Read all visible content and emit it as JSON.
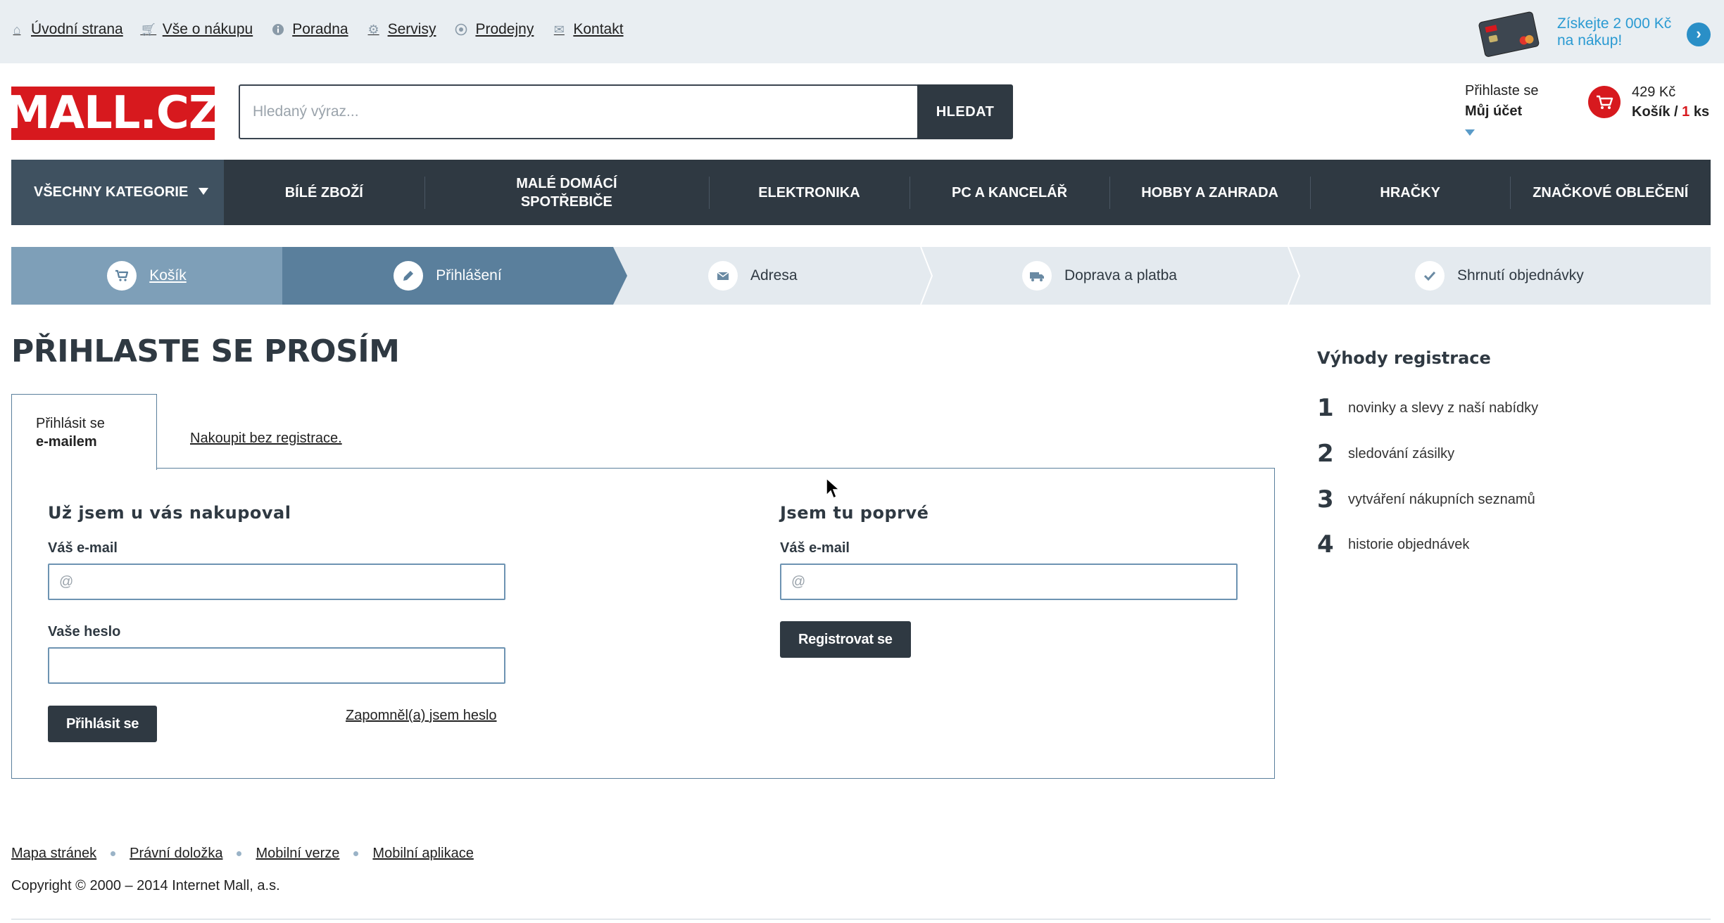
{
  "toplinks": [
    {
      "label": "Úvodní strana",
      "icon": "home-icon"
    },
    {
      "label": "Vše o nákupu",
      "icon": "cart-icon"
    },
    {
      "label": "Poradna",
      "icon": "info-icon"
    },
    {
      "label": "Servisy",
      "icon": "gear-icon"
    },
    {
      "label": "Prodejny",
      "icon": "store-icon"
    },
    {
      "label": "Kontakt",
      "icon": "mail-icon"
    }
  ],
  "promo": {
    "line1": "Získejte 2 000 Kč",
    "line2": "na nákup!"
  },
  "header": {
    "logo": "MALL.CZ",
    "search_placeholder": "Hledaný výraz...",
    "search_button": "HLEDAT",
    "account_line1": "Přihlaste se",
    "account_line2": "Můj účet",
    "cart_price": "429 Kč",
    "cart_label": "Košík / ",
    "cart_qty": "1",
    "cart_unit": " ks"
  },
  "categories": {
    "all": "VŠECHNY KATEGORIE",
    "items": [
      "BÍLÉ ZBOŽÍ",
      "MALÉ DOMÁCÍ SPOTŘEBIČE",
      "ELEKTRONIKA",
      "PC A KANCELÁŘ",
      "HOBBY A ZAHRADA",
      "HRAČKY",
      "ZNAČKOVÉ OBLEČENÍ"
    ]
  },
  "steps": [
    {
      "label": "Košík",
      "icon": "cart-icon",
      "state": "done"
    },
    {
      "label": "Přihlášení",
      "icon": "pencil-icon",
      "state": "active"
    },
    {
      "label": "Adresa",
      "icon": "envelope-icon",
      "state": "pending"
    },
    {
      "label": "Doprava a platba",
      "icon": "truck-icon",
      "state": "pending"
    },
    {
      "label": "Shrnutí objednávky",
      "icon": "check-icon",
      "state": "pending"
    }
  ],
  "page_title": "PŘIHLASTE SE PROSÍM",
  "tabs": {
    "active_line1": "Přihlásit se",
    "active_line2": "e-mailem",
    "guest_link": "Nakoupit bez registrace."
  },
  "login": {
    "title": "Už jsem u vás nakupoval",
    "email_label": "Váš e-mail",
    "email_placeholder": "@",
    "password_label": "Vaše heslo",
    "submit": "Přihlásit se",
    "forgot": "Zapomněl(a) jsem heslo"
  },
  "register": {
    "title": "Jsem tu poprvé",
    "email_label": "Váš e-mail",
    "email_placeholder": "@",
    "submit": "Registrovat se"
  },
  "benefits": {
    "title": "Výhody registrace",
    "items": [
      {
        "num": "1",
        "text": "novinky a slevy z naší nabídky"
      },
      {
        "num": "2",
        "text": "sledování zásilky"
      },
      {
        "num": "3",
        "text": "vytváření nákupních seznamů"
      },
      {
        "num": "4",
        "text": "historie objednávek"
      }
    ]
  },
  "footer": {
    "links": [
      "Mapa stránek",
      "Právní doložka",
      "Mobilní verze",
      "Mobilní aplikace"
    ],
    "copyright": "Copyright © 2000 – 2014 Internet Mall, a.s."
  },
  "colors": {
    "brand_red": "#d7191e",
    "dark": "#2f3942",
    "step_active": "#5a7f9c",
    "step_done": "#7e9fb8",
    "link_blue": "#2a9ad2"
  }
}
